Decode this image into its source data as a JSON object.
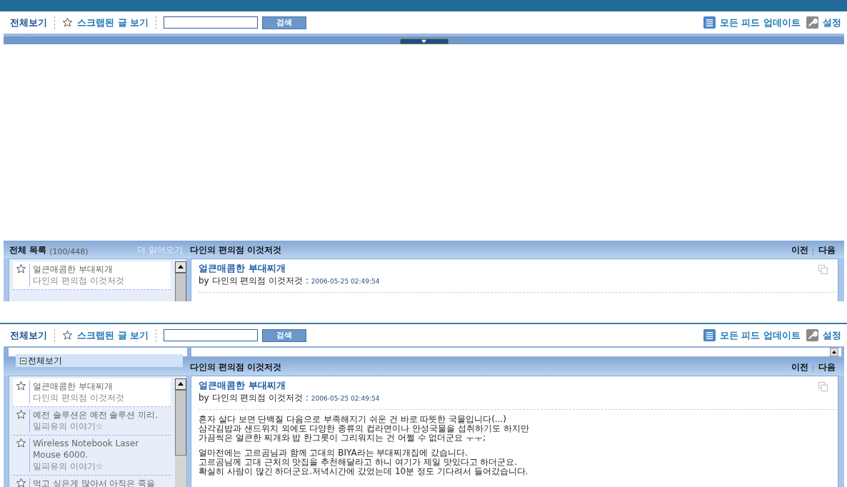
{
  "screens": [
    {
      "kind": "collapsed",
      "tabs": [
        {
          "label": "전체보기",
          "selected": true,
          "kind": "all"
        },
        {
          "label": "스크랩된 글 보기",
          "selected": false,
          "kind": "scrap"
        }
      ],
      "search_button": "검색",
      "update_all": "모든 피드 업데이트",
      "settings": "설정",
      "list_header": {
        "title": "전체 목록",
        "count": "(100/448)",
        "more": "더 읽어오기"
      },
      "feed_title": "다인의 편의점 이것저것",
      "prev": "이전",
      "next": "다음",
      "items": [
        {
          "title": "얼큰매콤한 부대찌개",
          "feed": "다인의 편의점 이것저것",
          "selected": true
        }
      ],
      "article": {
        "title": "얼큰매콤한 부대찌개",
        "byline": "by 다인의 편의점 이것저것 :",
        "date": "2006-05-25 02:49:54"
      }
    },
    {
      "kind": "dropdown",
      "dropdown": {
        "option": "전체보기"
      },
      "tabs": [
        {
          "label": "전체보기",
          "selected": true,
          "kind": "all"
        },
        {
          "label": "스크랩된 글 보기",
          "selected": false,
          "kind": "scrap"
        }
      ],
      "search_button": "검색",
      "update_all": "모든 피드 업데이트",
      "settings": "설정",
      "feed_title": "다인의 편의점 이것저것",
      "prev": "이전",
      "next": "다음",
      "items": [
        {
          "title": "얼큰매콤한 부대찌개",
          "feed": "다인의 편의점 이것저것",
          "selected": true
        },
        {
          "title": "예전 솔루션은 예전 솔루션 끼리.",
          "feed": "밀피유의 이야기☆",
          "selected": false
        },
        {
          "title": "Wireless Notebook Laser Mouse 6000.",
          "feed": "밀피유의 이야기☆",
          "selected": false
        },
        {
          "title": "먹고 싶은게 많아서 아직은 죽을",
          "selected": false
        }
      ],
      "article": {
        "title": "얼큰매콤한 부대찌개",
        "byline": "by 다인의 편의점 이것저것 :",
        "date": "2006-05-25 02:49:54",
        "paragraphs": [
          [
            "혼자 살다 보면 단백질 다음으로 부족해지기 쉬운 건 바로 따뜻한 국물입니다(...)",
            "삼각김밥과 샌드위치 외에도 다양한 종류의 컵라면이나 안성국물을 섭취하기도 하지만",
            "가끔씩은 얼큰한 찌개와 밥 한그릇이 그리워지는 건 어쩔 수 없더군요 ㅜㅜ;"
          ],
          [
            "얼마전에는 고르곰님과 함께 고대의 BIYA라는 부대찌개집에 갔습니다.",
            "고르곰님께 고대 근처의 맛집을 추천해달라고 하니 여기가 제일 맛있다고 하더군요.",
            "확실히 사람이 많긴 하더군요.저녁시간에 갔었는데 10분 정도 기다려서 들어갔습니다."
          ]
        ]
      }
    }
  ]
}
